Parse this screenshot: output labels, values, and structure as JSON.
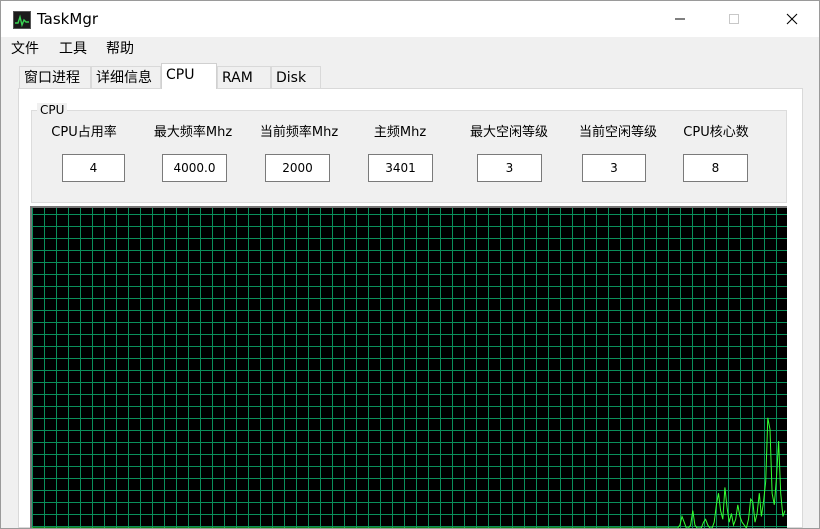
{
  "window": {
    "title": "TaskMgr",
    "icon": "task-manager-icon"
  },
  "menu": [
    "文件",
    "工具",
    "帮助"
  ],
  "tabs": [
    {
      "label": "窗口进程",
      "active": false
    },
    {
      "label": "详细信息",
      "active": false
    },
    {
      "label": "CPU",
      "active": true
    },
    {
      "label": "RAM",
      "active": false
    },
    {
      "label": "Disk",
      "active": false
    }
  ],
  "cpu_group": {
    "title": "CPU",
    "fields": [
      {
        "label": "CPU占用率",
        "value": "4"
      },
      {
        "label": "最大频率Mhz",
        "value": "4000.0"
      },
      {
        "label": "当前频率Mhz",
        "value": "2000"
      },
      {
        "label": "主频Mhz",
        "value": "3401"
      },
      {
        "label": "最大空闲等级",
        "value": "3"
      },
      {
        "label": "当前空闲等级",
        "value": "3"
      },
      {
        "label": "CPU核心数",
        "value": "8"
      }
    ]
  },
  "graph": {
    "background": "#000000",
    "grid_color": "#0a8f5a",
    "line_color": "#33ff33",
    "usage_percent": [
      0,
      0,
      0,
      0,
      0,
      0,
      0,
      0,
      0,
      0,
      0,
      0,
      0,
      0,
      0,
      0,
      0,
      0,
      0,
      0,
      0,
      0,
      0,
      0,
      0,
      0,
      0,
      0,
      0,
      0,
      0,
      0,
      0,
      0,
      0,
      0,
      0,
      0,
      0,
      0,
      0,
      0,
      0,
      0,
      0,
      0,
      0,
      0,
      0,
      0,
      0,
      0,
      0,
      0,
      0,
      0,
      0,
      0,
      0,
      0,
      0,
      0,
      0,
      0,
      0,
      0,
      0,
      0,
      0,
      0,
      0,
      0,
      0,
      0,
      0,
      0,
      0,
      0,
      0,
      0,
      0,
      0,
      0,
      0,
      0,
      0,
      0,
      0,
      0,
      0,
      0,
      0,
      0,
      0,
      0,
      0,
      0,
      0,
      0,
      0,
      0,
      0,
      0,
      0,
      0,
      0,
      0,
      0,
      0,
      0,
      0,
      0,
      0,
      0,
      0,
      0,
      0,
      0,
      0,
      0,
      0,
      0,
      0,
      0,
      0,
      0,
      0,
      0,
      0,
      0,
      0,
      0,
      0,
      0,
      0,
      0,
      0,
      0,
      0,
      0,
      0,
      0,
      0,
      0,
      0,
      0,
      0,
      0,
      0,
      0,
      0,
      0,
      0,
      0,
      0,
      0,
      0,
      0,
      0,
      0,
      0,
      0,
      0,
      0,
      0,
      0,
      0,
      0,
      0,
      0,
      0,
      0,
      0,
      0,
      0,
      0,
      0,
      0,
      0,
      0,
      0,
      0,
      0,
      0,
      0,
      0,
      0,
      0,
      0,
      0,
      0,
      0,
      0,
      0,
      0,
      0,
      0,
      0,
      0,
      0,
      0,
      0,
      0,
      0,
      0,
      0,
      0,
      0,
      0,
      0,
      0,
      0,
      0,
      0,
      0,
      0,
      0,
      0,
      0,
      0,
      0,
      0,
      0,
      0,
      0,
      0,
      0,
      0,
      0,
      0,
      0,
      0,
      0,
      0,
      0,
      0,
      0,
      0,
      0,
      0,
      0,
      0,
      0,
      0,
      0,
      0,
      0,
      0,
      0,
      0,
      0,
      0,
      0,
      0,
      0,
      0,
      0,
      0,
      0,
      0,
      0,
      0,
      0,
      0,
      0,
      0,
      0,
      0,
      0,
      0,
      0,
      0,
      0,
      0,
      0,
      0,
      0,
      0,
      0,
      0,
      0,
      0,
      0,
      0,
      0,
      0,
      0,
      0,
      0,
      0,
      0,
      0,
      0,
      0,
      0,
      0,
      0,
      0,
      0,
      0,
      0,
      0,
      1,
      4,
      2,
      0,
      0,
      1,
      6,
      1,
      0,
      0,
      0,
      2,
      3,
      1,
      0,
      0,
      2,
      8,
      12,
      6,
      3,
      14,
      7,
      2,
      5,
      1,
      3,
      8,
      4,
      2,
      1,
      0,
      3,
      10,
      9,
      2,
      5,
      12,
      4,
      9,
      16,
      38,
      34,
      12,
      8,
      17,
      30,
      12,
      4,
      6
    ]
  }
}
